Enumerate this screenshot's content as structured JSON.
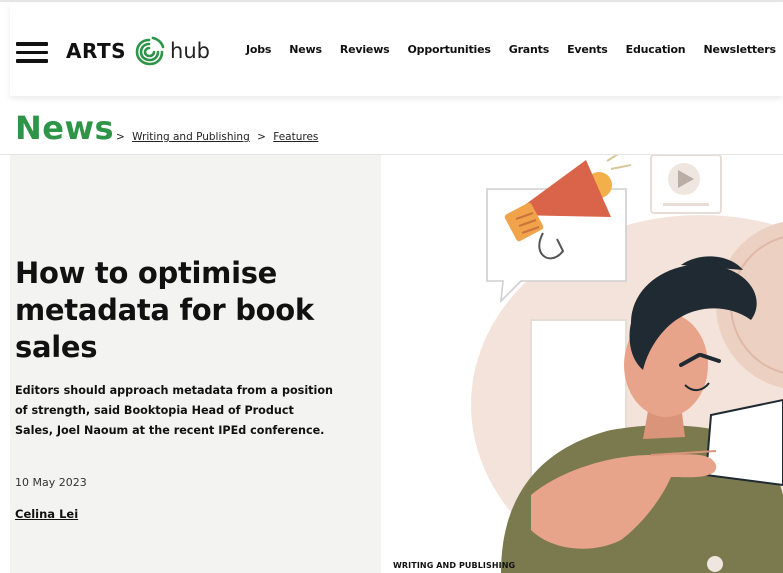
{
  "brand": {
    "name_left": "ARTS",
    "name_right": "hub",
    "accent_green": "#2e9448",
    "logo_icon": "artshub-swirl-icon"
  },
  "nav": {
    "items": [
      "Jobs",
      "News",
      "Reviews",
      "Opportunities",
      "Grants",
      "Events",
      "Education",
      "Newsletters"
    ]
  },
  "section": {
    "title": "News"
  },
  "breadcrumb": {
    "sep": ">",
    "items": [
      "Writing and Publishing",
      "Features"
    ]
  },
  "article": {
    "headline": "How to optimise metadata for book sales",
    "standfirst": "Editors should approach metadata from a position of strength, said Booktopia Head of Product Sales, Joel Naoum at the recent IPEd conference.",
    "date": "10 May 2023",
    "author": "Celina Lei",
    "category": "WRITING AND PUBLISHING"
  },
  "illustration": {
    "icons": [
      "megaphone-icon",
      "play-button-icon",
      "speech-bubble-icon"
    ],
    "colors": {
      "skin": "#e8a48a",
      "hair": "#1f2a32",
      "sweater": "#7a7a4e",
      "megaphone": "#d9644a",
      "backdrop": "#f2ddd2"
    }
  }
}
